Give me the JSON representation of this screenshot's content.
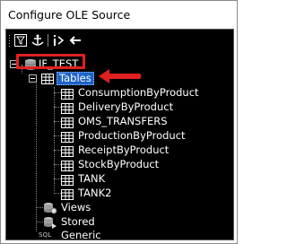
{
  "window": {
    "title": "Configure OLE Source"
  },
  "toolbar": {
    "buttons": [
      {
        "name": "filter-icon"
      },
      {
        "name": "anchor-icon"
      },
      {
        "name": "info-icon"
      },
      {
        "name": "back-arrow-icon"
      }
    ]
  },
  "tree": {
    "root": {
      "label": "IF_TEST"
    },
    "tables": {
      "label": "Tables",
      "items": [
        "ConsumptionByProduct",
        "DeliveryByProduct",
        "OMS_TRANSFERS",
        "ProductionByProduct",
        "ReceiptByProduct",
        "StockByProduct",
        "TANK",
        "TANK2"
      ]
    },
    "views": {
      "label": "Views"
    },
    "stored": {
      "label": "Stored"
    },
    "generic": {
      "label": "Generic",
      "icon_text": "SQL"
    }
  },
  "annotations": {
    "highlight_color": "#e02020",
    "selection_color": "#1e63c7"
  }
}
